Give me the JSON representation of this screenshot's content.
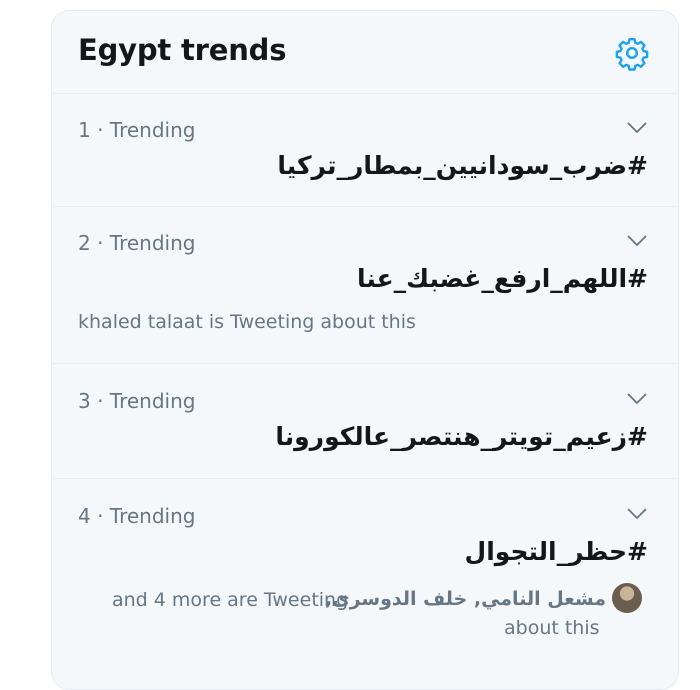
{
  "panel": {
    "title": "Egypt trends"
  },
  "trends": [
    {
      "meta": "1 · Trending",
      "tag": "#ضرب_سودانيين_بمطار_تركيا"
    },
    {
      "meta": "2 · Trending",
      "tag": "#اللهم_ارفع_غضبك_عنا",
      "context": "khaled talaat is Tweeting about this"
    },
    {
      "meta": "3 · Trending",
      "tag": "#زعيم_تويتر_هنتصر_عالكورونا"
    },
    {
      "meta": "4 · Trending",
      "tag": "#حظر_التجوال",
      "names": "مشعل النامي, خلف الدوسري,",
      "context_line1": "and 4 more are Tweeting",
      "context_line2": "about this"
    }
  ],
  "colors": {
    "accent": "#1da1f2",
    "text_primary": "#14171a",
    "text_secondary": "#657786",
    "panel_bg": "#f5f8fa",
    "divider": "#e6ecf0"
  },
  "icons": {
    "settings": "gear-icon",
    "more": "chevron-down-icon"
  }
}
